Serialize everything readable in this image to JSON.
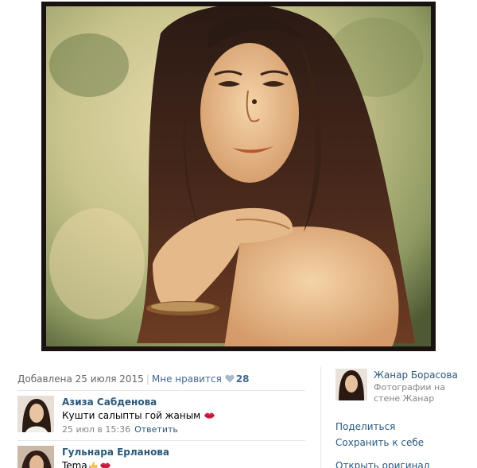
{
  "meta": {
    "added": "Добавлена 25 июля 2015",
    "separator": "|",
    "like_label": "Мне нравится",
    "like_count": "28"
  },
  "comments": [
    {
      "author": "Азиза Сабденова",
      "text": "Кушти салыпты гой жаным",
      "time": "25 июл в 15:36",
      "reply_label": "Ответить",
      "emoji": "kiss-lips"
    },
    {
      "author": "Гульнара Ерланова",
      "text": "Tema",
      "emoji": "thumbs-up-and-lips"
    }
  ],
  "owner": {
    "name": "Жанар Борасова",
    "subtitle": "Фотографии на стене Жанар"
  },
  "actions": {
    "share": "Поделиться",
    "save": "Сохранить к себе",
    "open_original": "Открыть оригинал"
  },
  "colors": {
    "link": "#2b587a",
    "meta": "#656565",
    "like_heart": "#a7b8cf",
    "divider": "#e4e7ea",
    "kiss": "#d6254c"
  }
}
